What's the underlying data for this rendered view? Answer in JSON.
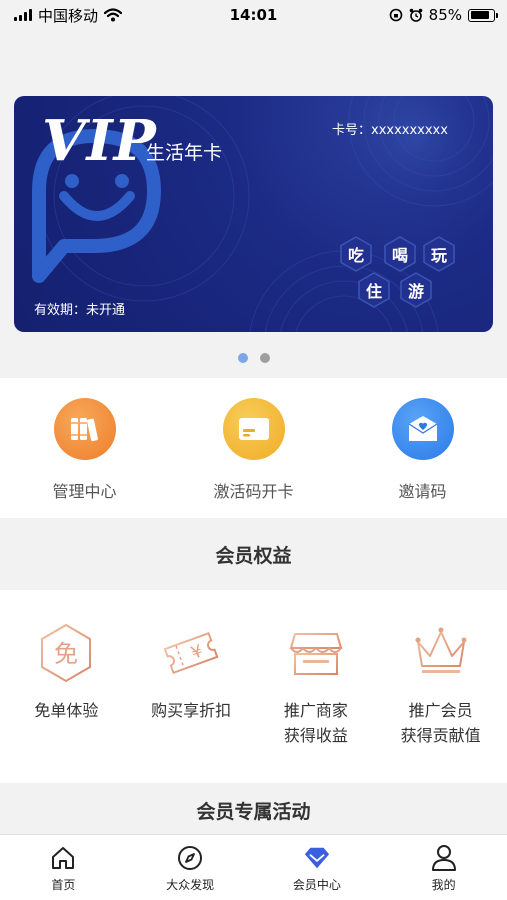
{
  "status_bar": {
    "carrier": "中国移动",
    "time": "14:01",
    "battery": "85%",
    "battery_level": 0.85
  },
  "card": {
    "title": "VIP",
    "subtitle": "生活年卡",
    "card_number": "卡号：xxxxxxxxxx",
    "validity": "有效期：未开通",
    "tags": [
      "吃",
      "喝",
      "玩",
      "住",
      "游"
    ]
  },
  "carousel": {
    "pages": 2,
    "active": 0
  },
  "quick_actions": [
    {
      "label": "管理中心",
      "icon": "books-icon",
      "color": "#f08d3d"
    },
    {
      "label": "激活码开卡",
      "icon": "card-icon",
      "color": "#f3b636"
    },
    {
      "label": "邀请码",
      "icon": "envelope-heart-icon",
      "color": "#3d8ef0"
    }
  ],
  "benefits_section": {
    "title": "会员权益",
    "items": [
      {
        "lines": [
          "免单体验"
        ],
        "icon": "free-hexagon-icon",
        "glyph": "免"
      },
      {
        "lines": [
          "购买享折扣"
        ],
        "icon": "coupon-ticket-icon",
        "glyph": "¥"
      },
      {
        "lines": [
          "推广商家",
          "获得收益"
        ],
        "icon": "storefront-icon"
      },
      {
        "lines": [
          "推广会员",
          "获得贡献值"
        ],
        "icon": "crown-icon"
      }
    ]
  },
  "activity_section": {
    "title": "会员专属活动"
  },
  "tabbar": [
    {
      "label": "首页",
      "icon": "home-icon"
    },
    {
      "label": "大众发现",
      "icon": "compass-icon"
    },
    {
      "label": "会员中心",
      "icon": "member-diamond-icon",
      "active": true
    },
    {
      "label": "我的",
      "icon": "user-icon"
    }
  ],
  "colors": {
    "card": "#1c2b86",
    "accent": "#3b5fe0",
    "benefit_gold": "#e6a98a"
  }
}
